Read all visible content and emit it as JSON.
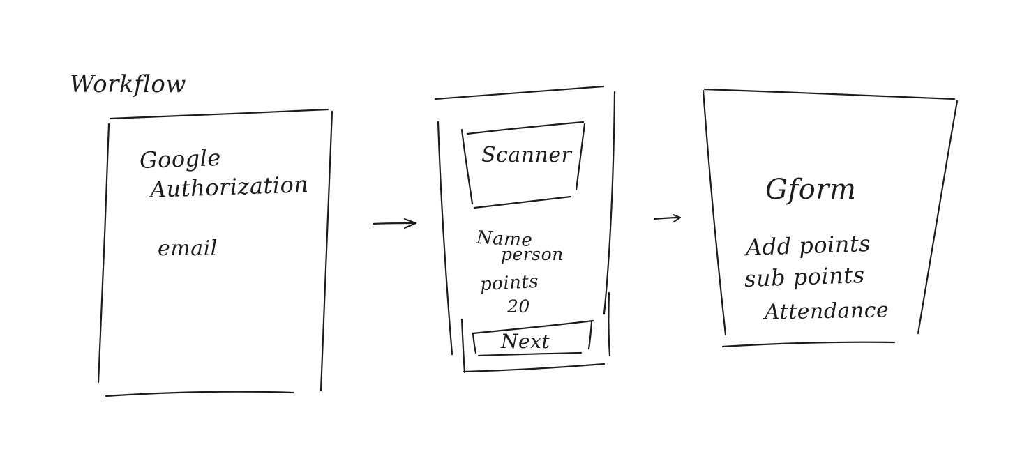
{
  "title": "Workflow",
  "screens": [
    {
      "lines": [
        "Google",
        "Authorization"
      ],
      "field": "email"
    },
    {
      "scanner_label": "Scanner",
      "name_label": "Name",
      "name_value": "person",
      "points_label": "points",
      "points_value": "20",
      "next_label": "Next"
    },
    {
      "title": "Gform",
      "items": [
        "Add points",
        "sub points",
        "Attendance"
      ]
    }
  ],
  "colors": {
    "ink": "#1c1c1c",
    "background": "#ffffff"
  }
}
